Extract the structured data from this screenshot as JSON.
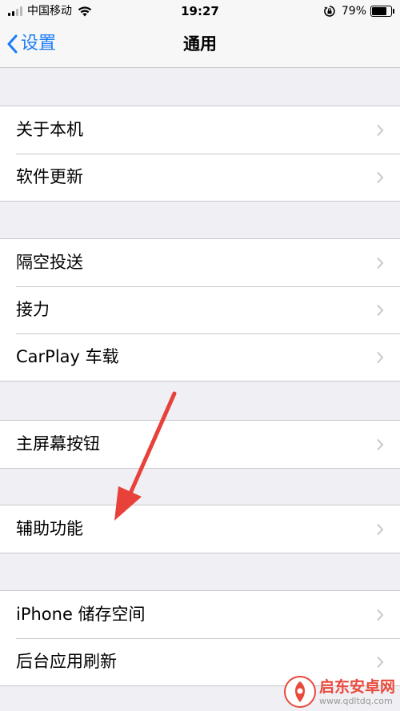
{
  "status_bar": {
    "carrier": "中国移动",
    "time": "19:27",
    "battery_percent": "79%",
    "battery_level": 0.79,
    "signal_bars_filled": 2,
    "signal_bars_total": 4
  },
  "nav": {
    "back_label": "设置",
    "title": "通用",
    "accent_color": "#1a7cf5"
  },
  "groups": [
    {
      "items": [
        {
          "label": "关于本机"
        },
        {
          "label": "软件更新"
        }
      ]
    },
    {
      "items": [
        {
          "label": "隔空投送"
        },
        {
          "label": "接力"
        },
        {
          "label": "CarPlay 车载"
        }
      ]
    },
    {
      "items": [
        {
          "label": "主屏幕按钮"
        }
      ]
    },
    {
      "items": [
        {
          "label": "辅助功能"
        }
      ]
    },
    {
      "items": [
        {
          "label": "iPhone 储存空间"
        },
        {
          "label": "后台应用刷新"
        }
      ]
    }
  ],
  "annotation": {
    "type": "arrow",
    "color": "#e8413a",
    "target": "辅助功能"
  },
  "watermark": {
    "title": "启东安卓网",
    "url": "www.qdltdq.com"
  }
}
